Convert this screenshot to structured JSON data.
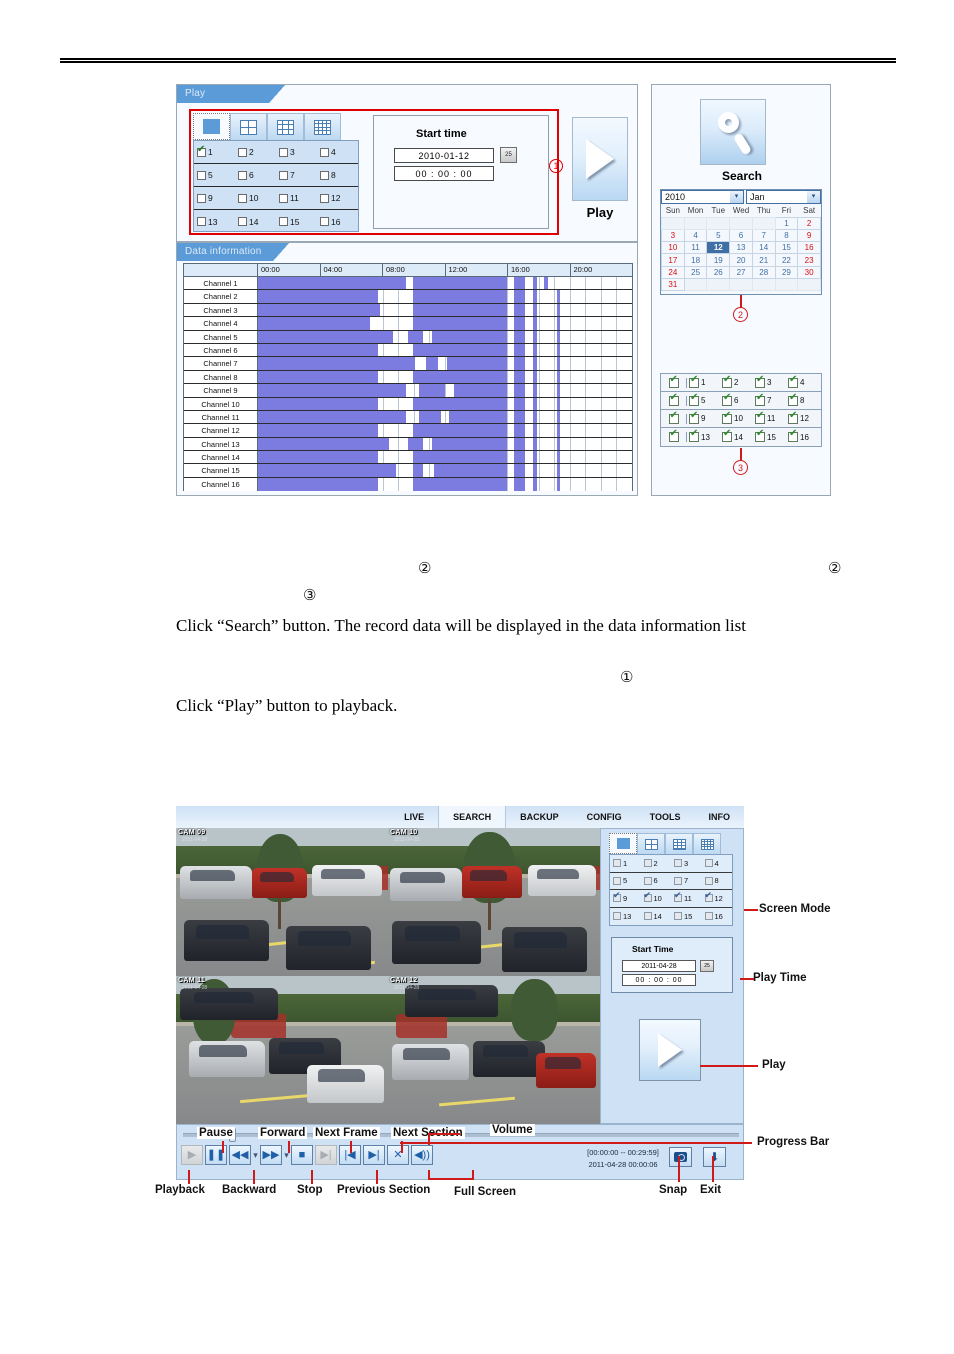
{
  "figure1": {
    "play_panel": {
      "tab_label": "Play",
      "screen_modes": [
        {
          "name": "single-view",
          "selected": true
        },
        {
          "name": "quad-view",
          "selected": false
        },
        {
          "name": "nine-view",
          "selected": false
        },
        {
          "name": "sixteen-view",
          "selected": false
        }
      ],
      "channels": [
        {
          "label": "1",
          "checked": true
        },
        {
          "label": "2",
          "checked": false
        },
        {
          "label": "3",
          "checked": false
        },
        {
          "label": "4",
          "checked": false
        },
        {
          "label": "5",
          "checked": false
        },
        {
          "label": "6",
          "checked": false
        },
        {
          "label": "7",
          "checked": false
        },
        {
          "label": "8",
          "checked": false
        },
        {
          "label": "9",
          "checked": false
        },
        {
          "label": "10",
          "checked": false
        },
        {
          "label": "11",
          "checked": false
        },
        {
          "label": "12",
          "checked": false
        },
        {
          "label": "13",
          "checked": false
        },
        {
          "label": "14",
          "checked": false
        },
        {
          "label": "15",
          "checked": false
        },
        {
          "label": "16",
          "checked": false
        }
      ],
      "start_time": {
        "title": "Start time",
        "date_value": "2010-01-12",
        "time_value": "00 : 00 : 00",
        "calendar_button_label": "25"
      },
      "play_button_label": "Play",
      "annotation": "1"
    },
    "data_panel": {
      "tab_label": "Data information",
      "time_ticks": [
        "00:00",
        "04:00",
        "08:00",
        "12:00",
        "16:00",
        "20:00"
      ],
      "channel_rows": [
        "Channel 1",
        "Channel 2",
        "Channel 3",
        "Channel 4",
        "Channel 5",
        "Channel 6",
        "Channel 7",
        "Channel 8",
        "Channel 9",
        "Channel 10",
        "Channel 11",
        "Channel 12",
        "Channel 13",
        "Channel 14",
        "Channel 15",
        "Channel 16"
      ]
    },
    "search_panel": {
      "search_button_label": "Search",
      "year_value": "2010",
      "month_value": "Jan",
      "weekday_headers": [
        "Sun",
        "Mon",
        "Tue",
        "Wed",
        "Thu",
        "Fri",
        "Sat"
      ],
      "selected_day": "12",
      "annotation_calendar": "2",
      "annotation_channels": "3",
      "channels": [
        {
          "label": "1"
        },
        {
          "label": "2"
        },
        {
          "label": "3"
        },
        {
          "label": "4"
        },
        {
          "label": "5"
        },
        {
          "label": "6"
        },
        {
          "label": "7"
        },
        {
          "label": "8"
        },
        {
          "label": "9"
        },
        {
          "label": "10"
        },
        {
          "label": "11"
        },
        {
          "label": "12"
        },
        {
          "label": "13"
        },
        {
          "label": "14"
        },
        {
          "label": "15"
        },
        {
          "label": "16"
        }
      ]
    }
  },
  "body_text": {
    "marker_a": "②",
    "marker_b": "②",
    "marker_c": "③",
    "marker_d": "①",
    "paragraph1": "Click “Search” button. The record data will be displayed in the data information list",
    "paragraph2": "Click “Play” button to playback."
  },
  "figure2": {
    "nav": [
      {
        "label": "LIVE",
        "active": false
      },
      {
        "label": "SEARCH",
        "active": true
      },
      {
        "label": "BACKUP",
        "active": false
      },
      {
        "label": "CONFIG",
        "active": false
      },
      {
        "label": "TOOLS",
        "active": false
      },
      {
        "label": "INFO",
        "active": false
      }
    ],
    "panes": [
      {
        "cam": "CAM 09",
        "sub": "2011-04-28"
      },
      {
        "cam": "CAM 10",
        "sub": "2011-04-28"
      },
      {
        "cam": "CAM 11",
        "sub": "2011-04-28"
      },
      {
        "cam": "CAM 12",
        "sub": "2011-04-28"
      }
    ],
    "screen_modes": [
      {
        "name": "single-view",
        "selected": true
      },
      {
        "name": "quad-view",
        "selected": false
      },
      {
        "name": "nine-view",
        "selected": false
      },
      {
        "name": "sixteen-view",
        "selected": false
      }
    ],
    "channels": [
      {
        "label": "1",
        "checked": false
      },
      {
        "label": "2",
        "checked": false
      },
      {
        "label": "3",
        "checked": false
      },
      {
        "label": "4",
        "checked": false
      },
      {
        "label": "5",
        "checked": false
      },
      {
        "label": "6",
        "checked": false
      },
      {
        "label": "7",
        "checked": false
      },
      {
        "label": "8",
        "checked": false
      },
      {
        "label": "9",
        "checked": true
      },
      {
        "label": "10",
        "checked": true
      },
      {
        "label": "11",
        "checked": true
      },
      {
        "label": "12",
        "checked": true
      },
      {
        "label": "13",
        "checked": false
      },
      {
        "label": "14",
        "checked": false
      },
      {
        "label": "15",
        "checked": false
      },
      {
        "label": "16",
        "checked": false
      }
    ],
    "start_time": {
      "title": "Start Time",
      "date_value": "2011-04-28",
      "time_value": "00 : 00 : 00",
      "calendar_button_label": "25"
    },
    "timecode": {
      "range": "[00:00:00 -- 00:29:59]",
      "current": "2011-04-28 00:00:06"
    },
    "callouts": {
      "pause": "Pause",
      "forward": "Forward",
      "next_frame": "Next Frame",
      "next_section": "Next Section",
      "volume": "Volume",
      "playback": "Playback",
      "backward": "Backward",
      "stop": "Stop",
      "previous_section": "Previous Section",
      "full_screen": "Full Screen",
      "screen_mode": "Screen Mode",
      "play_time": "Play Time",
      "play": "Play",
      "progress_bar": "Progress Bar",
      "snap": "Snap",
      "exit": "Exit"
    }
  }
}
